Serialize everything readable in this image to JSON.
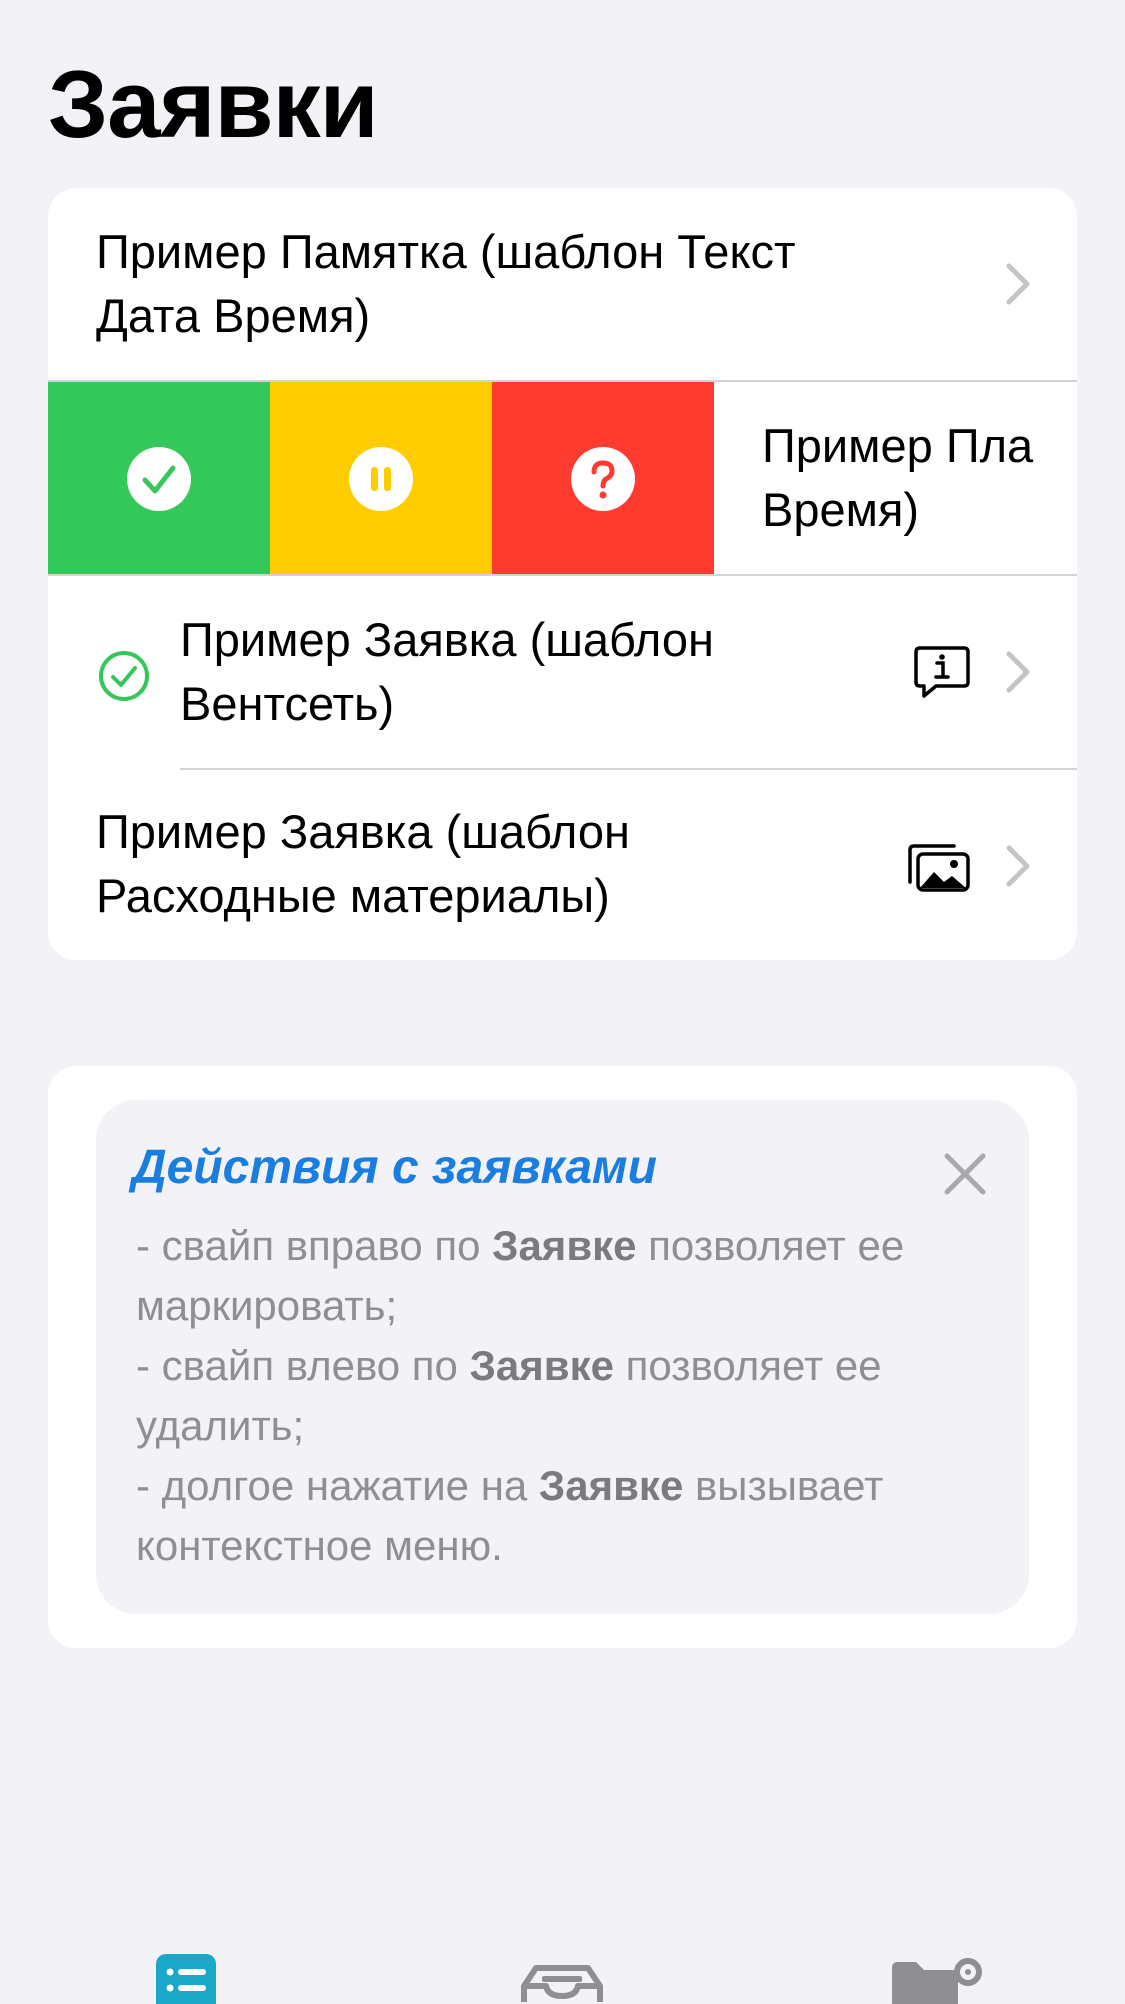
{
  "header": {
    "title": "Заявки"
  },
  "list": {
    "items": [
      {
        "label": "Пример Памятка (шаблон Текст Дата Время)",
        "line1": "Пример Памятка (шаблон Текст",
        "line2": "Дата Время)"
      },
      {
        "label": "Пример Планировка (шаблон Текст Дата Время)",
        "line1": "Пример Пла",
        "line2": "Время)",
        "swipe_actions": [
          "mark-done",
          "pause",
          "question"
        ]
      },
      {
        "label": "Пример Заявка (шаблон Вентсеть)",
        "line1": "Пример Заявка (шаблон",
        "line2": "Вентсеть)",
        "status_icon": "check-circle-icon",
        "accessory_icon": "info-bubble-icon"
      },
      {
        "label": "Пример Заявка (шаблон Расходные материалы)",
        "line1": "Пример Заявка (шаблон",
        "line2": "Расходные материалы)",
        "accessory_icon": "photos-icon"
      }
    ]
  },
  "swipe": {
    "colors": {
      "done": "#34C759",
      "pause": "#FFCC00",
      "question": "#FF3B30"
    }
  },
  "tip": {
    "title": "Действия с заявками",
    "lines": [
      {
        "pre": "- свайп вправо по ",
        "bold": "Заявке",
        "post": " позволяет ее маркировать;"
      },
      {
        "pre": "- свайп влево по ",
        "bold": "Заявке",
        "post": " позволяет ее удалить;"
      },
      {
        "pre": "- долгое нажатие на ",
        "bold": "Заявке",
        "post": " вызывает контекстное меню."
      }
    ]
  },
  "tabbar": {
    "tabs": [
      {
        "icon": "list-icon",
        "active": true
      },
      {
        "icon": "inbox-tray-icon",
        "active": false
      },
      {
        "icon": "folder-settings-icon",
        "active": false
      }
    ]
  },
  "colors": {
    "accent": "#1A7DE0",
    "background": "#F2F2F7",
    "secondary_text": "#8E8E93"
  }
}
